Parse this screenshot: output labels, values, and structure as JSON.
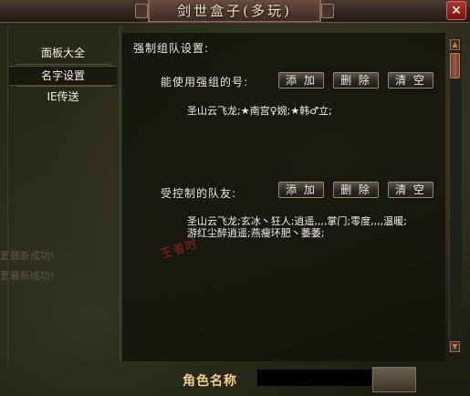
{
  "window": {
    "title": "剑世盒子(多玩)",
    "close_glyph": "✕"
  },
  "sidebar": {
    "items": [
      {
        "label": "面板大全"
      },
      {
        "label": "名字设置"
      },
      {
        "label": "IE传送"
      }
    ]
  },
  "main": {
    "section_title": "强制组队设置:",
    "row1": {
      "label": "能使用强组的号:",
      "add": "添 加",
      "delete": "删 除",
      "clear": "清 空",
      "content": "圣山云飞龙;★南宫♀婉;★韩♂立;"
    },
    "row2": {
      "label": "受控制的队友:",
      "add": "添 加",
      "delete": "删 除",
      "clear": "清 空",
      "content_line1": "圣山云飞龙;玄冰丶狂人;逍遥,,,,掌门;零度,,,,温暖;",
      "content_line2": "游红尘醉逍遥;燕瘦环肥丶萎萎;"
    }
  },
  "background_text": [
    "置最新成功!",
    "置最新成功!"
  ],
  "watermark": "王者时",
  "bottom": {
    "label": "角色名称"
  },
  "colors": {
    "accent": "#a25a3a",
    "title": "#f2dcc0",
    "label_gold": "#f0d090"
  }
}
